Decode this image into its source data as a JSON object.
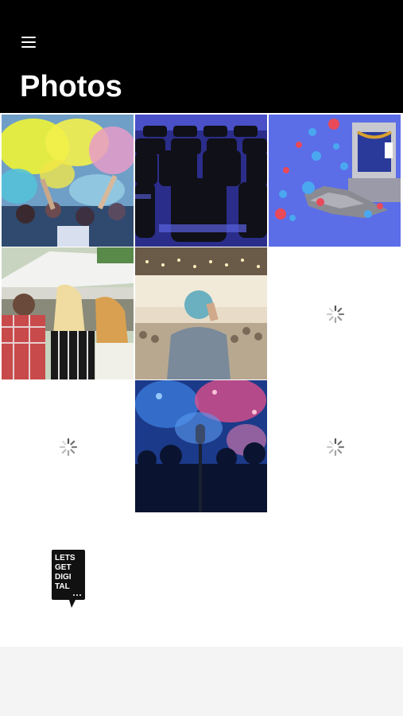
{
  "header": {
    "menu_icon": "hamburger-menu-icon",
    "title": "Photos"
  },
  "grid": {
    "columns": 3,
    "photos": [
      {
        "id": "photo-festival-colors",
        "state": "loaded",
        "subject": "color powder festival crowd"
      },
      {
        "id": "photo-auditorium-chairs",
        "state": "loaded",
        "subject": "rows of auditorium chairs"
      },
      {
        "id": "photo-reaction-stage",
        "state": "loaded",
        "subject": "stage illustration with heart and like reactions"
      },
      {
        "id": "photo-outdoor-crowd",
        "state": "loaded",
        "subject": "people at outdoor event tent"
      },
      {
        "id": "photo-conference-speaker",
        "state": "loaded",
        "subject": "speaker in front of audience"
      },
      {
        "id": "photo-loading-1",
        "state": "loading"
      },
      {
        "id": "photo-loading-2",
        "state": "loading"
      },
      {
        "id": "photo-concert-mic",
        "state": "loaded",
        "subject": "microphone at concert"
      },
      {
        "id": "photo-loading-3",
        "state": "loading"
      },
      {
        "id": "photo-logo",
        "state": "loaded",
        "subject": "logo",
        "logo_lines": [
          "LETS",
          "GET",
          "DIGI",
          "TAL"
        ]
      }
    ]
  },
  "colors": {
    "header_bg": "#000000",
    "header_text": "#ffffff",
    "grid_bg": "#ffffff",
    "page_bg": "#f4f4f4",
    "spinner": "#555555"
  }
}
